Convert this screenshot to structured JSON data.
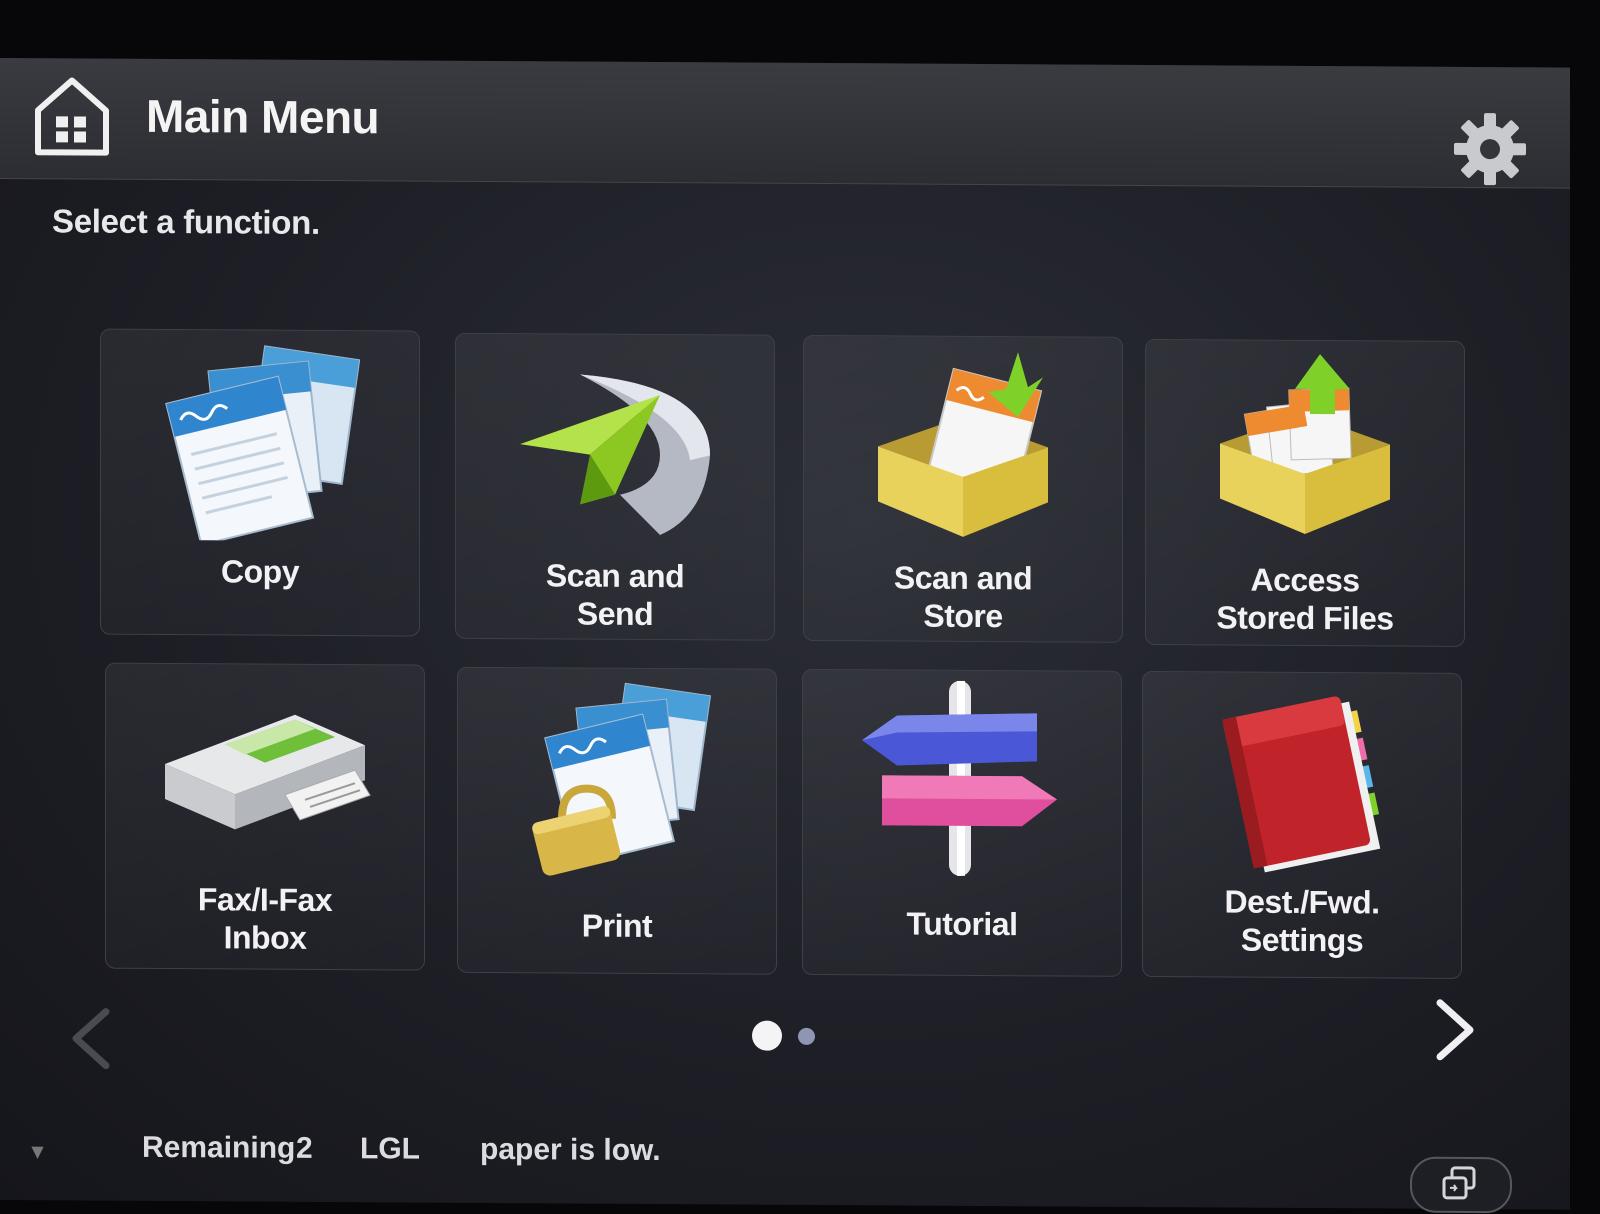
{
  "header": {
    "title": "Main Menu"
  },
  "prompt": "Select a function.",
  "tiles": [
    {
      "label_lines": [
        "",
        "Copy"
      ]
    },
    {
      "label_lines": [
        "Scan and",
        "Send"
      ]
    },
    {
      "label_lines": [
        "Scan and",
        "Store"
      ]
    },
    {
      "label_lines": [
        "Access",
        "Stored Files"
      ]
    },
    {
      "label_lines": [
        "Fax/I-Fax",
        "Inbox"
      ]
    },
    {
      "label_lines": [
        "",
        "Print"
      ]
    },
    {
      "label_lines": [
        "",
        "Tutorial"
      ]
    },
    {
      "label_lines": [
        "Dest./Fwd.",
        "Settings"
      ]
    }
  ],
  "pagination": {
    "current_page": 1,
    "page_count": 2
  },
  "status": {
    "remaining_label": "Remaining",
    "remaining_count": "2",
    "paper_size": "LGL",
    "message": "paper is low."
  },
  "icons": {
    "home": "home-icon",
    "settings": "gear-icon",
    "prev": "chevron-left-icon",
    "next": "chevron-right-icon",
    "switch": "switch-screen-icon"
  },
  "colors": {
    "background": "#1e1f26",
    "titlebar": "#333439",
    "text": "#f2f2f4"
  }
}
